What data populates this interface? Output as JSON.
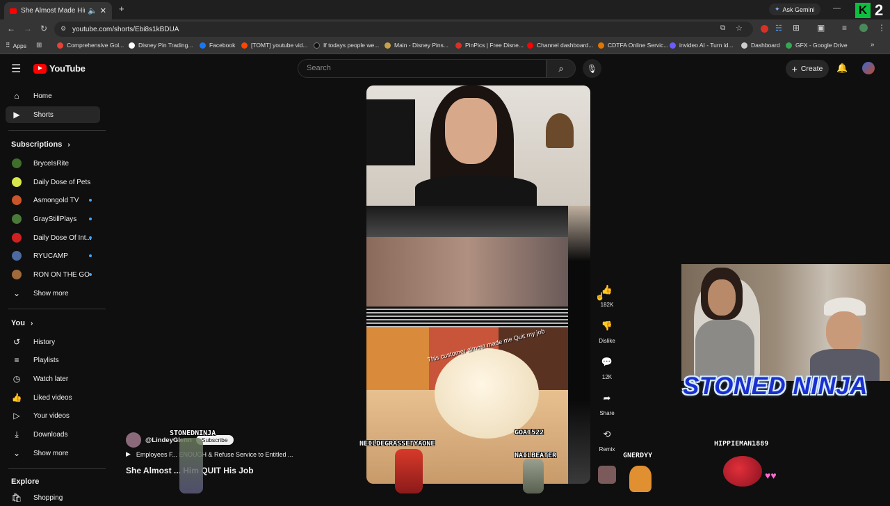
{
  "browser": {
    "tab_title": "She Almost Made Him QUIT",
    "url": "youtube.com/shorts/Ebi8s1kBDUA",
    "ask_gemini": "Ask Gemini",
    "bookmarks": [
      {
        "label": "Apps",
        "color": "#9aa0a6"
      },
      {
        "label": "Comprehensive Gol...",
        "color": "#e94235"
      },
      {
        "label": "Disney Pin Trading...",
        "color": "#ffffff"
      },
      {
        "label": "Facebook",
        "color": "#1877f2"
      },
      {
        "label": "[TOMT] youtube vid...",
        "color": "#ff4500"
      },
      {
        "label": "If todays people we...",
        "color": "#000000"
      },
      {
        "label": "Main - Disney Pins...",
        "color": "#c8a24a"
      },
      {
        "label": "PinPics | Free Disne...",
        "color": "#d93025"
      },
      {
        "label": "Channel dashboard...",
        "color": "#ff0000"
      },
      {
        "label": "CDTFA Online Servic...",
        "color": "#e37400"
      },
      {
        "label": "invideo AI - Turn id...",
        "color": "#6b5cff"
      },
      {
        "label": "Dashboard",
        "color": "#cccccc"
      },
      {
        "label": "GFX - Google Drive",
        "color": "#34a853"
      }
    ],
    "overlay_badge": "2"
  },
  "header": {
    "logo_text": "YouTube",
    "search_placeholder": "Search",
    "create_label": "Create"
  },
  "sidebar": {
    "main": [
      {
        "label": "Home",
        "icon": "home-icon"
      },
      {
        "label": "Shorts",
        "icon": "shorts-icon"
      }
    ],
    "subscriptions_heading": "Subscriptions",
    "subscriptions": [
      {
        "label": "BryceIsRite",
        "color": "#3f6f2a",
        "dot": false
      },
      {
        "label": "Daily Dose of Pets",
        "color": "#d8e84a",
        "dot": false
      },
      {
        "label": "Asmongold TV",
        "color": "#c8562a",
        "dot": true
      },
      {
        "label": "GrayStillPlays",
        "color": "#4a7a3a",
        "dot": true
      },
      {
        "label": "Daily Dose Of Int...",
        "color": "#d02020",
        "dot": true
      },
      {
        "label": "RYUCAMP",
        "color": "#4a6aa0",
        "dot": true
      },
      {
        "label": "RON ON THE GO",
        "color": "#a06a3a",
        "dot": true
      }
    ],
    "show_more_1": "Show more",
    "you_heading": "You",
    "you_items": [
      {
        "label": "History",
        "icon": "history-icon"
      },
      {
        "label": "Playlists",
        "icon": "playlists-icon"
      },
      {
        "label": "Watch later",
        "icon": "watch-later-icon"
      },
      {
        "label": "Liked videos",
        "icon": "liked-videos-icon"
      },
      {
        "label": "Your videos",
        "icon": "your-videos-icon"
      },
      {
        "label": "Downloads",
        "icon": "downloads-icon"
      }
    ],
    "show_more_2": "Show more",
    "explore_heading": "Explore",
    "shopping": "Shopping"
  },
  "short": {
    "overlay_caption": "This customer almost made me Quit my job",
    "channel_handle": "@LindeyGlenn",
    "subscribe_label": "Subscribe",
    "related_video": "Employees F... ENOUGH & Refuse Service to Entitled ...",
    "title": "She Almost ... Him QUIT His Job",
    "likes": "182K",
    "dislike_label": "Dislike",
    "comments": "12K",
    "share_label": "Share",
    "remix_label": "Remix"
  },
  "stream_overlay": {
    "logo_text": "STONED NINJA",
    "chatters": [
      "STONEDNINJA",
      "NEILDEGRASSETYAONE",
      "GOAT522",
      "NAILBEATER",
      "GNERDYY",
      "HIPPIEMAN1889"
    ]
  }
}
